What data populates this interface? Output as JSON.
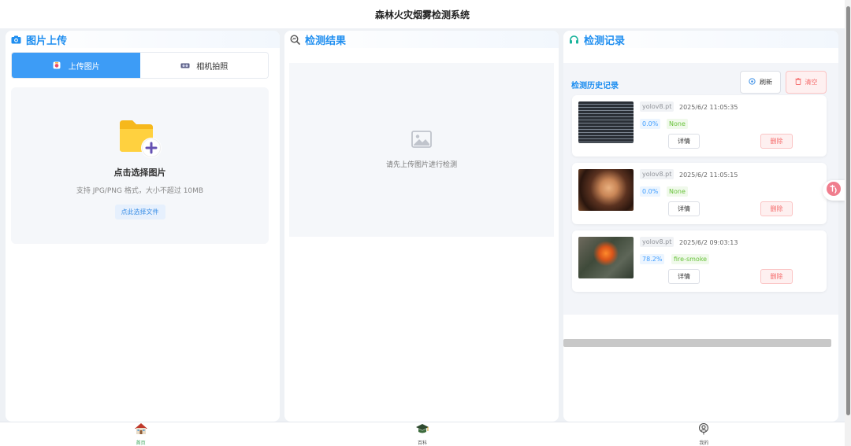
{
  "header": {
    "title": "森林火灾烟雾检测系统"
  },
  "upload_panel": {
    "title": "图片上传",
    "tabs": [
      {
        "label": "上传图片"
      },
      {
        "label": "相机拍照"
      }
    ],
    "drop_title": "点击选择图片",
    "drop_hint": "支持 JPG/PNG 格式，大小不超过 10MB",
    "choose_button": "点此选择文件"
  },
  "result_panel": {
    "title": "检测结果",
    "placeholder": "请先上传图片进行检测"
  },
  "records_panel": {
    "title": "检测记录",
    "history_title": "检测历史记录",
    "refresh_label": "刷新",
    "clear_label": "清空",
    "records": [
      {
        "model": "yolov8.pt",
        "time": "2025/6/2 11:05:35",
        "confidence": "0.0%",
        "class": "None",
        "detail_label": "详情",
        "delete_label": "删除",
        "thumb": "terminal-screenshot"
      },
      {
        "model": "yolov8.pt",
        "time": "2025/6/2 11:05:15",
        "confidence": "0.0%",
        "class": "None",
        "detail_label": "详情",
        "delete_label": "删除",
        "thumb": "portrait-photo"
      },
      {
        "model": "yolov8.pt",
        "time": "2025/6/2 09:03:13",
        "confidence": "78.2%",
        "class": "fire-smoke",
        "detail_label": "详情",
        "delete_label": "删除",
        "thumb": "forest-fire-photo"
      }
    ]
  },
  "bottom_nav": [
    {
      "label": "首页",
      "icon": "house-icon",
      "active": true
    },
    {
      "label": "百科",
      "icon": "graduation-cap-icon",
      "active": false
    },
    {
      "label": "我的",
      "icon": "user-icon",
      "active": false
    }
  ],
  "colors": {
    "accent": "#1e8ef0",
    "tab_active": "#3d9cf6",
    "danger": "#f56c6c",
    "success": "#67c23a"
  }
}
